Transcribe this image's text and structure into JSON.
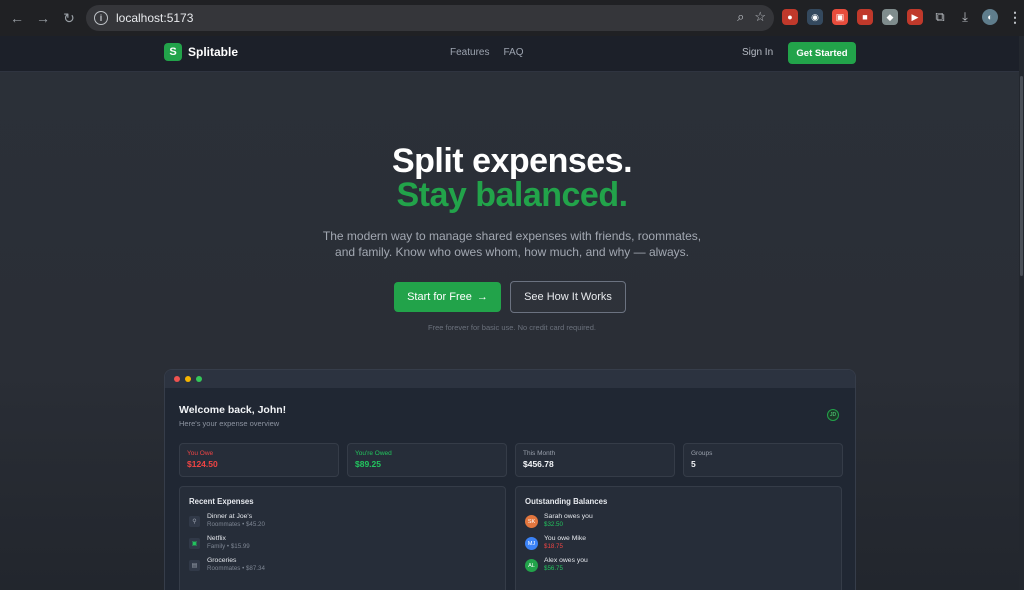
{
  "browser": {
    "url": "localhost:5173"
  },
  "site": {
    "brand_letter": "S",
    "brand_name": "Splitable",
    "nav": [
      "Features",
      "FAQ"
    ],
    "sign_in": "Sign In",
    "get_started": "Get Started"
  },
  "hero": {
    "title_line1": "Split expenses.",
    "title_line2": "Stay balanced.",
    "subtitle": "The modern way to manage shared expenses with friends, roommates, and family. Know who owes whom, how much, and why — always.",
    "primary_cta": "Start for Free",
    "primary_cta_icon": "→",
    "secondary_cta": "See How It Works",
    "fineprint": "Free forever for basic use. No credit card required."
  },
  "dashboard": {
    "welcome": "Welcome back, John!",
    "welcome_sub": "Here's your expense overview",
    "avatar_initials": "JD",
    "stats": [
      {
        "label": "You Owe",
        "value": "$124.50",
        "color": "#ef4444"
      },
      {
        "label": "You're Owed",
        "value": "$89.25",
        "color": "#22c55e"
      },
      {
        "label": "This Month",
        "value": "$456.78",
        "color": "#f2f4f7"
      },
      {
        "label": "Groups",
        "value": "5",
        "color": "#f2f4f7"
      }
    ],
    "recent_title": "Recent Expenses",
    "recent": [
      {
        "name": "Dinner at Joe's",
        "meta": "Roommates • $45.20",
        "icon": "⚲"
      },
      {
        "name": "Netflix",
        "meta": "Family • $15.99",
        "icon": "▣"
      },
      {
        "name": "Groceries",
        "meta": "Roommates • $87.34",
        "icon": "▤"
      }
    ],
    "balances_title": "Outstanding Balances",
    "balances": [
      {
        "initials": "SK",
        "text": "Sarah owes you",
        "amount": "$32.50",
        "color": "#22c55e",
        "avatar_color": "#e2763e"
      },
      {
        "initials": "MJ",
        "text": "You owe Mike",
        "amount": "$18.75",
        "color": "#ef4444",
        "avatar_color": "#3b82f6"
      },
      {
        "initials": "AL",
        "text": "Alex owes you",
        "amount": "$56.75",
        "color": "#22c55e",
        "avatar_color": "#22a34a"
      }
    ]
  }
}
